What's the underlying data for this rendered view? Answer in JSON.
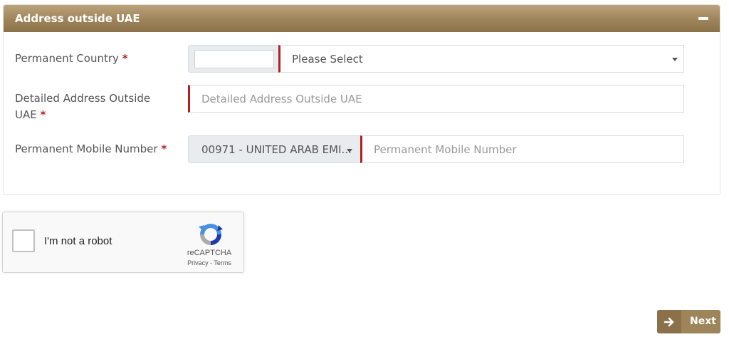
{
  "panel": {
    "title": "Address outside UAE",
    "collapse_symbol": "minus-icon"
  },
  "form": {
    "permanent_country": {
      "label": "Permanent Country",
      "required_mark": "*",
      "code_value": "",
      "select_value": "Please Select"
    },
    "detailed_address": {
      "label_line1": "Detailed Address Outside",
      "label_line2": "UAE",
      "required_mark": "*",
      "placeholder": "Detailed Address Outside UAE",
      "value": ""
    },
    "permanent_mobile": {
      "label": "Permanent Mobile Number",
      "required_mark": "*",
      "country_code_value": "00971 - UNITED ARAB EMI...",
      "placeholder": "Permanent Mobile Number",
      "value": ""
    }
  },
  "captcha": {
    "label": "I'm not a robot",
    "brand": "reCAPTCHA",
    "privacy": "Privacy",
    "separator": " - ",
    "terms": "Terms",
    "checked": false
  },
  "actions": {
    "next_label": "Next",
    "next_icon": "arrow-right-icon"
  },
  "colors": {
    "header_gold": "#9e8459",
    "required_red": "#b21f24",
    "input_accent": "#b21f24"
  }
}
